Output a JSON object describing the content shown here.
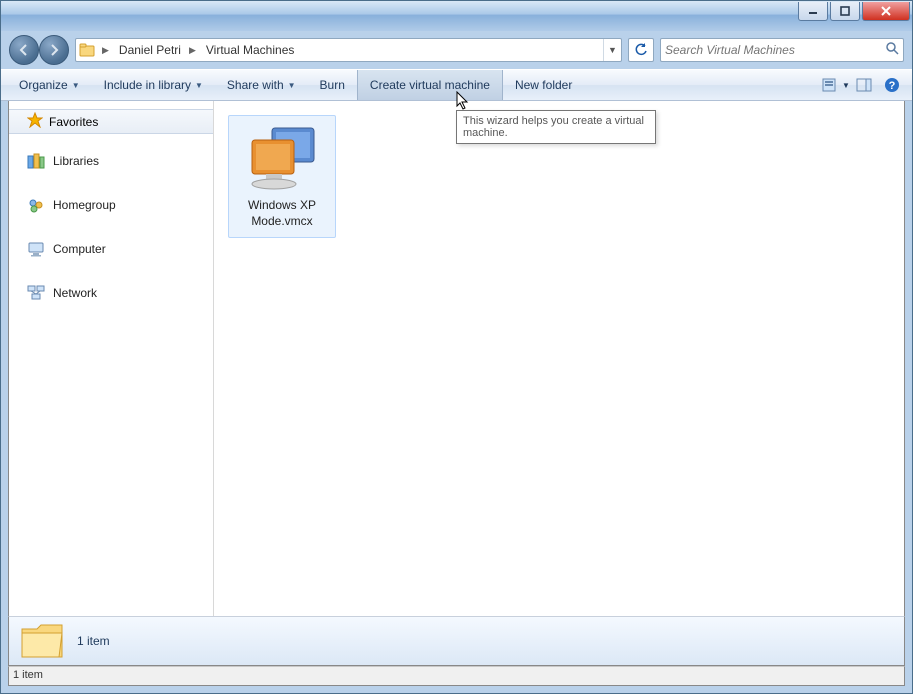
{
  "titlebar": {
    "minimize_tip": "Minimize",
    "maximize_tip": "Maximize",
    "close_tip": "Close"
  },
  "nav": {
    "back_tip": "Back",
    "forward_tip": "Forward"
  },
  "address": {
    "crumbs": [
      "Daniel Petri",
      "Virtual Machines"
    ],
    "dropdown_tip": "Previous Locations",
    "refresh_tip": "Refresh"
  },
  "search": {
    "placeholder": "Search Virtual Machines"
  },
  "toolbar": {
    "organize": "Organize",
    "include": "Include in library",
    "share": "Share with",
    "burn": "Burn",
    "create_vm": "Create virtual machine",
    "new_folder": "New folder",
    "view_tip": "Change your view",
    "preview_tip": "Show the preview pane",
    "help_tip": "Get help"
  },
  "navpane": {
    "favorites": "Favorites",
    "items": [
      {
        "label": "Libraries",
        "icon": "libraries-icon"
      },
      {
        "label": "Homegroup",
        "icon": "homegroup-icon"
      },
      {
        "label": "Computer",
        "icon": "computer-icon"
      },
      {
        "label": "Network",
        "icon": "network-icon"
      }
    ]
  },
  "files": [
    {
      "name": "Windows XP Mode.vmcx",
      "icon": "virtual-machine-icon"
    }
  ],
  "tooltip": {
    "text": "This wizard helps you create a virtual machine."
  },
  "details": {
    "summary": "1 item"
  },
  "status": {
    "text": "1 item"
  }
}
